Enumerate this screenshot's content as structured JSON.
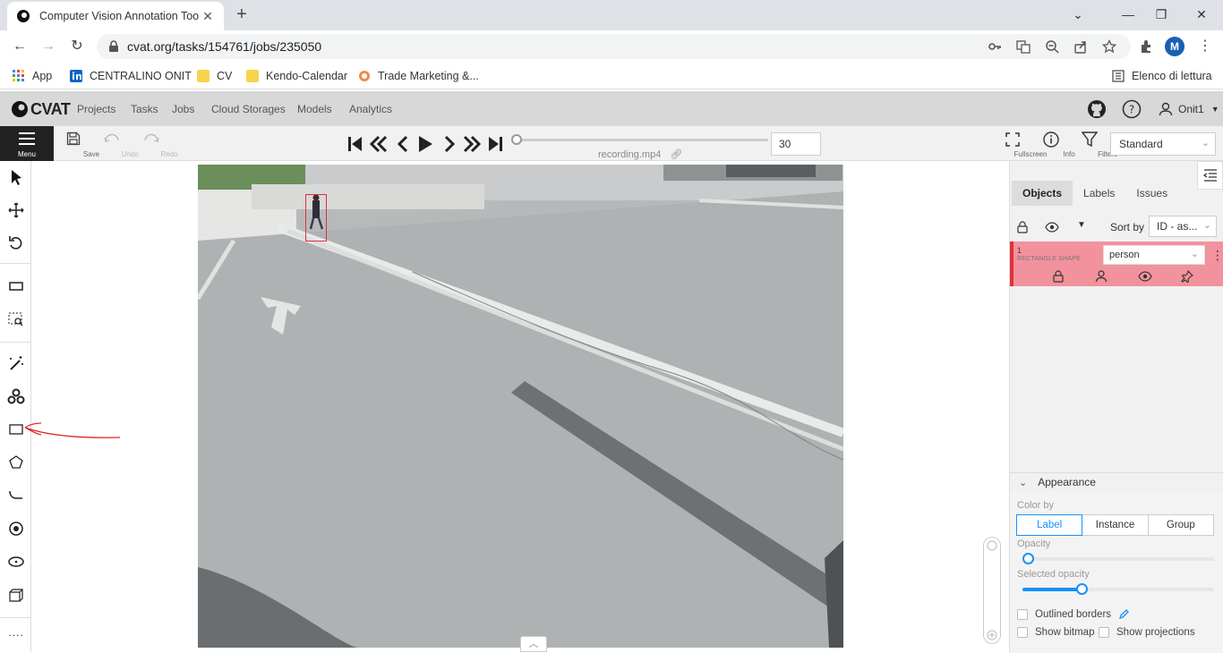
{
  "browser": {
    "tab_title": "Computer Vision Annotation Too",
    "new_tab": "+",
    "url": "cvat.org/tasks/154761/jobs/235050",
    "profile_initial": "M",
    "bookmarks": [
      {
        "label": "App",
        "icon": "apps-grid-icon"
      },
      {
        "label": "CENTRALINO ONIT",
        "icon": "linkedin-icon"
      },
      {
        "label": "CV",
        "icon": "folder-icon"
      },
      {
        "label": "Kendo-Calendar",
        "icon": "folder-icon"
      },
      {
        "label": "Trade Marketing &...",
        "icon": "site-icon"
      }
    ],
    "reading_list": "Elenco di lettura"
  },
  "header": {
    "logo": "CVAT",
    "nav": [
      "Projects",
      "Tasks",
      "Jobs",
      "Cloud Storages",
      "Models",
      "Analytics"
    ],
    "user": "Onit1"
  },
  "player": {
    "menu_label": "Menu",
    "save_label": "Save",
    "undo_label": "Undo",
    "redo_label": "Redo",
    "filename": "recording.mp4",
    "frame": "30",
    "frame_progress": 0.0,
    "fullscreen_label": "Fullscreen",
    "info_label": "Info",
    "filters_label": "Filters",
    "workspace": "Standard"
  },
  "sidebar": {
    "tabs": [
      "Objects",
      "Labels",
      "Issues"
    ],
    "active_tab": "Objects",
    "sort_by_label": "Sort by",
    "sort_value": "ID - as...",
    "objects": [
      {
        "id": "1",
        "type": "RECTANGLE SHAPE",
        "label": "person",
        "color": "#e0303c"
      }
    ]
  },
  "appearance": {
    "title": "Appearance",
    "color_by_label": "Color by",
    "color_by_options": [
      "Label",
      "Instance",
      "Group"
    ],
    "color_by_selected": "Label",
    "opacity_label": "Opacity",
    "opacity_value": 0.0,
    "selected_opacity_label": "Selected opacity",
    "selected_opacity_value": 0.3,
    "outlined_borders": "Outlined borders",
    "show_bitmap": "Show bitmap",
    "show_projections": "Show projections"
  },
  "colors": {
    "accent": "#1890ff",
    "annotation": "#e0303c",
    "object_bg": "#f2929d"
  }
}
